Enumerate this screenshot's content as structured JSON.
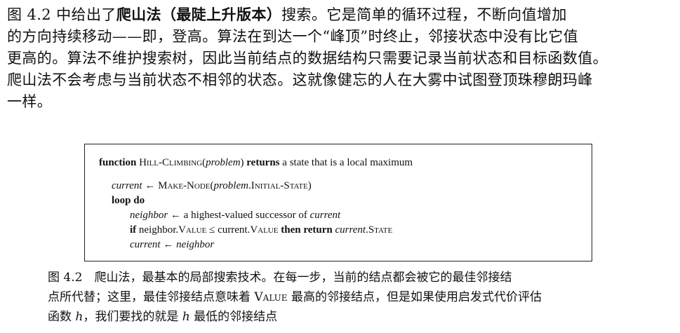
{
  "paragraph": {
    "l1_a": "图 4.2 中给出了",
    "l1_b": "爬山法（最陡上升版本）",
    "l1_c": "搜索。它是简单的循环过程，不断向值增加",
    "l2": "的方向持续移动——即，登高。算法在到达一个“峰顶”时终止，邻接状态中没有比它值",
    "l3": "更高的。算法不维护搜索树，因此当前结点的数据结构只需要记录当前状态和目标函数值。",
    "l4": "爬山法不会考虑与当前状态不相邻的状态。这就像健忘的人在大雾中试图登顶珠穆朗玛峰",
    "l5": "一样。"
  },
  "algorithm": {
    "l1": {
      "kw1": "function",
      "name": "Hill-Climbing",
      "p1": "(",
      "arg": "problem",
      "p2": ")",
      "kw2": "returns",
      "rest": "a state that is a local maximum"
    },
    "l2": {
      "var": "current",
      "arrow": " ← ",
      "fn": "Make-Node",
      "p1": "(",
      "arg": "problem",
      "field": ".Initial-State",
      "p2": ")"
    },
    "l3": {
      "kw": "loop do"
    },
    "l4": {
      "var": "neighbor",
      "arrow": " ← ",
      "rest": "a highest-valued successor of ",
      "var2": "current"
    },
    "l5": {
      "kw1": "if",
      "a": " neighbor.",
      "v1": "Value",
      "op": " ≤ ",
      "b": "current.",
      "v2": "Value",
      "kw2": "then return",
      "var": "current",
      "field": ".State"
    },
    "l6": {
      "var": "current",
      "arrow": " ← ",
      "var2": "neighbor"
    }
  },
  "caption": {
    "l1": "图 4.2　爬山法，最基本的局部搜索技术。在每一步，当前的结点都会被它的最佳邻接结",
    "l2_a": "点所代替；这里，最佳邻接结点意味着 ",
    "l2_sc": "Value",
    "l2_b": " 最高的邻接结点，但是如果使用启发式代价评估",
    "l3_a": "函数 ",
    "l3_h": "h",
    "l3_b": "，我们要找的就是 ",
    "l3_h2": "h",
    "l3_c": " 最低的邻接结点"
  }
}
